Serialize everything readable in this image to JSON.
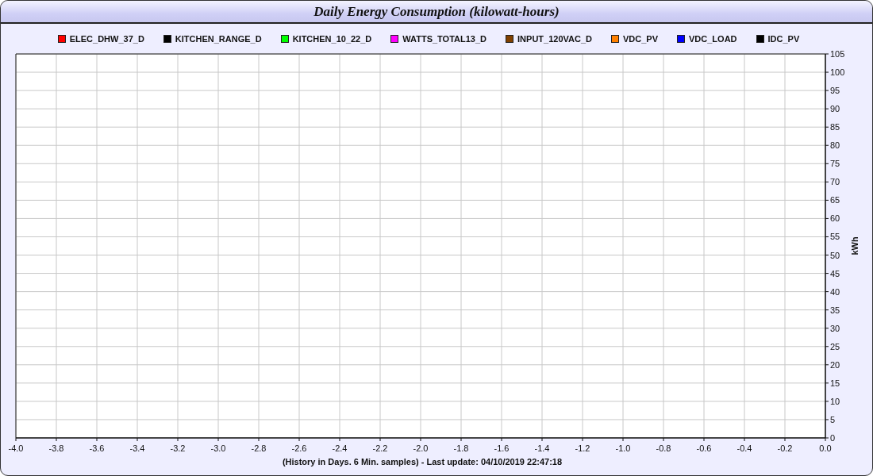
{
  "title": "Daily Energy Consumption (kilowatt-hours)",
  "chart_data": {
    "type": "line",
    "xlabel": "(History in Days. 6 Min. samples) - Last update: 04/10/2019 22:47:18",
    "ylabel": "kWh",
    "series": [
      {
        "name": "ELEC_DHW_37_D",
        "color": "#ff0000",
        "values": [
          null,
          null,
          null,
          null,
          null,
          null,
          null,
          null,
          null,
          null,
          null,
          null,
          null,
          null,
          null,
          null,
          null,
          null,
          null,
          null,
          null
        ]
      },
      {
        "name": "KITCHEN_RANGE_D",
        "color": "#000000",
        "values": [
          null,
          null,
          null,
          null,
          null,
          null,
          null,
          null,
          null,
          null,
          null,
          null,
          null,
          null,
          null,
          null,
          null,
          null,
          null,
          null,
          null
        ]
      },
      {
        "name": "KITCHEN_10_22_D",
        "color": "#00ff00",
        "values": [
          null,
          null,
          null,
          null,
          null,
          null,
          null,
          null,
          null,
          null,
          null,
          null,
          null,
          null,
          null,
          null,
          null,
          null,
          null,
          null,
          null
        ]
      },
      {
        "name": "WATTS_TOTAL13_D",
        "color": "#ff00ff",
        "values": [
          null,
          null,
          null,
          null,
          null,
          null,
          null,
          null,
          null,
          null,
          null,
          null,
          null,
          null,
          null,
          null,
          null,
          null,
          null,
          null,
          null
        ]
      },
      {
        "name": "INPUT_120VAC_D",
        "color": "#804000",
        "values": [
          null,
          null,
          null,
          null,
          null,
          null,
          null,
          null,
          null,
          null,
          null,
          null,
          null,
          null,
          null,
          null,
          null,
          null,
          null,
          null,
          null
        ]
      },
      {
        "name": "VDC_PV",
        "color": "#ff8000",
        "values": [
          null,
          null,
          null,
          null,
          null,
          null,
          null,
          null,
          null,
          null,
          null,
          null,
          null,
          null,
          null,
          null,
          null,
          null,
          null,
          null,
          null
        ]
      },
      {
        "name": "VDC_LOAD",
        "color": "#0000ff",
        "values": [
          null,
          null,
          null,
          null,
          null,
          null,
          null,
          null,
          null,
          null,
          null,
          null,
          null,
          null,
          null,
          null,
          null,
          null,
          null,
          null,
          null
        ]
      },
      {
        "name": "IDC_PV",
        "color": "#000000",
        "values": [
          null,
          null,
          null,
          null,
          null,
          null,
          null,
          null,
          null,
          null,
          null,
          null,
          null,
          null,
          null,
          null,
          null,
          null,
          null,
          null,
          null
        ]
      }
    ],
    "categories": [
      "-4.0",
      "-3.8",
      "-3.6",
      "-3.4",
      "-3.2",
      "-3.0",
      "-2.8",
      "-2.6",
      "-2.4",
      "-2.2",
      "-2.0",
      "-1.8",
      "-1.6",
      "-1.4",
      "-1.2",
      "-1.0",
      "-0.8",
      "-0.6",
      "-0.4",
      "-0.2",
      "0.0"
    ],
    "ylim": [
      0,
      105
    ],
    "grid": true,
    "yticks": [
      0,
      5,
      10,
      15,
      20,
      25,
      30,
      35,
      40,
      45,
      50,
      55,
      60,
      65,
      70,
      75,
      80,
      85,
      90,
      95,
      100,
      105
    ]
  }
}
